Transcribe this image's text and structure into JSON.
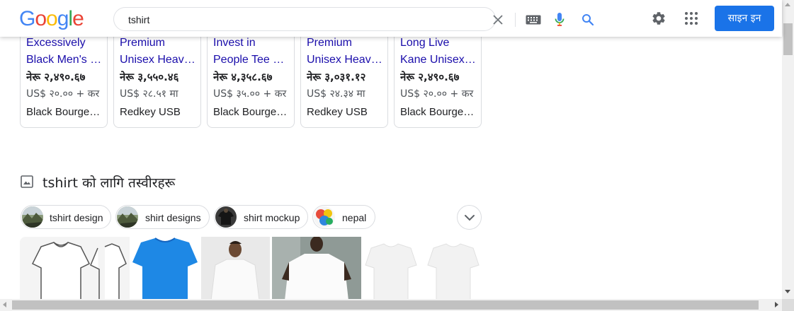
{
  "header": {
    "logo_letters": [
      "G",
      "o",
      "o",
      "g",
      "l",
      "e"
    ],
    "search_value": "tshirt",
    "signin_label": "साइन इन"
  },
  "colors": {
    "accent": "#1a73e8",
    "link": "#1a0dab",
    "logo": [
      "#4285f4",
      "#ea4335",
      "#fbbc05",
      "#4285f4",
      "#34a853",
      "#ea4335"
    ]
  },
  "products": [
    {
      "title_line1": "Excessively",
      "title_line2": "Black Men's Graphic Tee",
      "price": "नेरू २,४९०.६७",
      "usd": "US$ २०.०० + कर",
      "store": "Black Bourgeois"
    },
    {
      "title_line1": "Premium",
      "title_line2": "Unisex Heavyweight",
      "price": "नेरू ३,५५०.४६",
      "usd": "US$ २८.५१ मा",
      "store": "Redkey USB"
    },
    {
      "title_line1": "Invest in",
      "title_line2": "People Tee Shirt",
      "price": "नेरू ४,३५८.६७",
      "usd": "US$ ३५.०० + कर",
      "store": "Black Bourgeois"
    },
    {
      "title_line1": "Premium",
      "title_line2": "Unisex Heavyweight",
      "price": "नेरू ३,०३१.१२",
      "usd": "US$ २४.३४ मा",
      "store": "Redkey USB"
    },
    {
      "title_line1": "Long Live",
      "title_line2": "Kane Unisex Tee",
      "price": "नेरू २,४९०.६७",
      "usd": "US$ २०.०० + कर",
      "store": "Black Bourgeois"
    }
  ],
  "images_section": {
    "heading": "tshirt को लागि तस्वीरहरू",
    "chips": [
      {
        "label": "tshirt design",
        "icon": "mountain-thumb"
      },
      {
        "label": "shirt designs",
        "icon": "mountain-thumb"
      },
      {
        "label": "shirt mockup",
        "icon": "dark-shirt-thumb"
      },
      {
        "label": "nepal",
        "icon": "colorful-thumb"
      }
    ]
  }
}
